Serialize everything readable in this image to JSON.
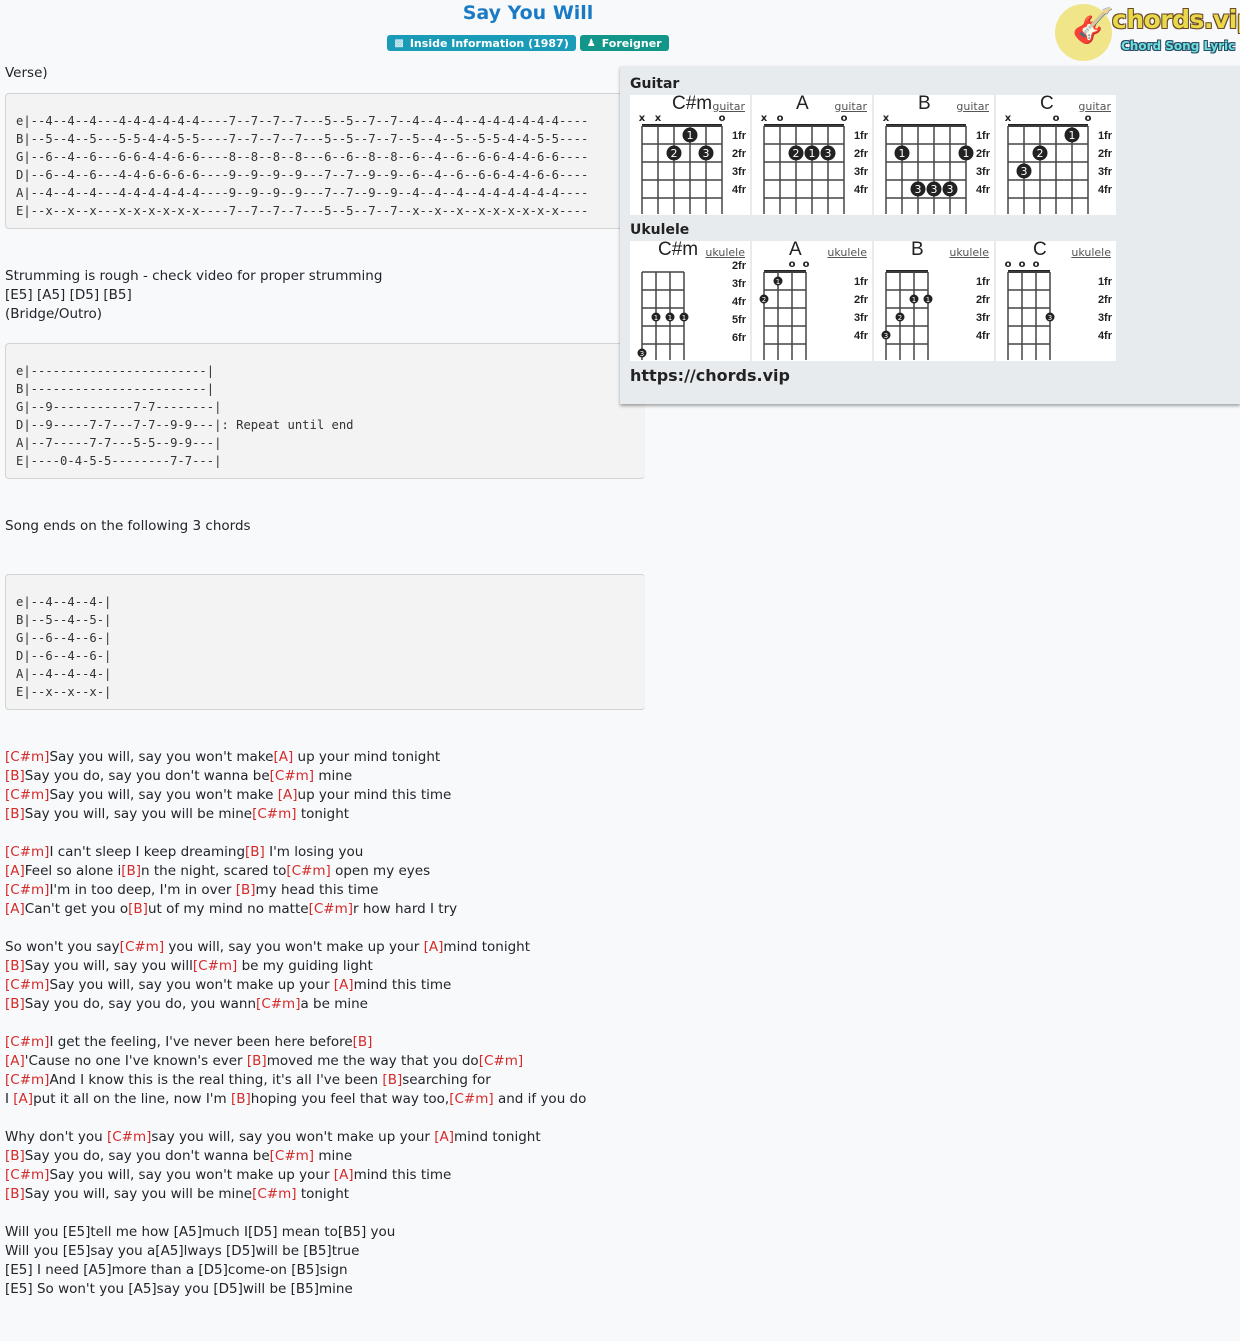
{
  "header": {
    "title": "Say You Will",
    "album_badge": "Inside Information (1987)",
    "artist_badge": "Foreigner",
    "album_icon": "book-icon",
    "artist_icon": "user-icon"
  },
  "logo": {
    "brand": "chords.vip",
    "tagline": "Chord Song Lyric",
    "icon": "guitar-icon"
  },
  "colors": {
    "title": "#1a7bc4",
    "album_badge": "#1a9bb8",
    "artist_badge": "#13968a",
    "chord": "#d42a2a"
  },
  "content": {
    "verse_label": "Verse)",
    "tab1": "e|--4--4--4---4-4-4-4-4-4----7--7--7--7---5--5--7--7--4--4--4--4-4-4-4-4-4----\nB|--5--4--5---5-5-4-4-5-5----7--7--7--7---5--5--7--7--5--4--5--5-5-4-4-5-5----\nG|--6--4--6---6-6-4-4-6-6----8--8--8--8---6--6--8--8--6--4--6--6-6-4-4-6-6----\nD|--6--4--6---4-4-6-6-6-6----9--9--9--9---7--7--9--9--6--4--6--6-6-4-4-6-6----\nA|--4--4--4---4-4-4-4-4-4----9--9--9--9---7--7--9--9--4--4--4--4-4-4-4-4-4----\nE|--x--x--x---x-x-x-x-x-x----7--7--7--7---5--5--7--7--x--x--x--x-x-x-x-x-x----",
    "strumming_note": "Strumming is rough - check video for proper strumming",
    "power_chords": "[E5] [A5] [D5] [B5]",
    "bridge_label": "(Bridge/Outro)",
    "tab2": "e|------------------------|\nB|------------------------|\nG|--9-----------7-7--------|\nD|--9-----7-7---7-7--9-9---|: Repeat until end\nA|--7-----7-7---5-5--9-9---|\nE|----0-4-5-5--------7-7---|",
    "ending_note": "Song ends on the following 3 chords",
    "tab3": "e|--4--4--4-|\nB|--5--4--5-|\nG|--6--4--6-|\nD|--6--4--6-|\nA|--4--4--4-|\nE|--x--x--x-|",
    "lyric_stanzas": [
      [
        [
          [
            "C#m",
            "Say you will, say you won't make"
          ],
          [
            "A",
            " up your mind tonight"
          ]
        ],
        [
          [
            "B",
            "Say you do, say you don't wanna be"
          ],
          [
            "C#m",
            " mine"
          ]
        ],
        [
          [
            "C#m",
            "Say you will, say you won't make "
          ],
          [
            "A",
            "up your mind this time"
          ]
        ],
        [
          [
            "B",
            "Say you will, say you will be mine"
          ],
          [
            "C#m",
            " tonight"
          ]
        ]
      ],
      [
        [
          [
            "C#m",
            "I can't sleep I keep dreaming"
          ],
          [
            "B",
            " I'm losing you"
          ]
        ],
        [
          [
            "A",
            "Feel so alone i"
          ],
          [
            "B",
            "n the night, scared to"
          ],
          [
            "C#m",
            " open my eyes"
          ]
        ],
        [
          [
            "C#m",
            "I'm in too deep, I'm in over "
          ],
          [
            "B",
            "my head this time"
          ]
        ],
        [
          [
            "A",
            "Can't get you o"
          ],
          [
            "B",
            "ut of my mind no matte"
          ],
          [
            "C#m",
            "r how hard I try"
          ]
        ]
      ],
      [
        [
          [
            "",
            "So won't you say"
          ],
          [
            "C#m",
            " you will, say you won't make up your "
          ],
          [
            "A",
            "mind tonight"
          ]
        ],
        [
          [
            "B",
            "Say you will, say you will"
          ],
          [
            "C#m",
            " be my guiding light"
          ]
        ],
        [
          [
            "C#m",
            "Say you will, say you won't make up your "
          ],
          [
            "A",
            "mind this time"
          ]
        ],
        [
          [
            "B",
            "Say you do, say you do, you wann"
          ],
          [
            "C#m",
            "a be mine"
          ]
        ]
      ],
      [
        [
          [
            "C#m",
            "I get the feeling, I've never been here before"
          ],
          [
            "B",
            ""
          ]
        ],
        [
          [
            "A",
            "'Cause no one I've known's ever "
          ],
          [
            "B",
            "moved me the way that you do"
          ],
          [
            "C#m",
            ""
          ]
        ],
        [
          [
            "C#m",
            "And I know this is the real thing, it's all I've been "
          ],
          [
            "B",
            "searching for"
          ]
        ],
        [
          [
            "",
            "I "
          ],
          [
            "A",
            "put it all on the line, now I'm "
          ],
          [
            "B",
            "hoping you feel that way too,"
          ],
          [
            "C#m",
            " and if you do"
          ]
        ]
      ],
      [
        [
          [
            "",
            "Why don't you "
          ],
          [
            "C#m",
            "say you will, say you won't make up your "
          ],
          [
            "A",
            "mind tonight"
          ]
        ],
        [
          [
            "B",
            "Say you do, say you don't wanna be"
          ],
          [
            "C#m",
            " mine"
          ]
        ],
        [
          [
            "C#m",
            "Say you will, say you won't make up your "
          ],
          [
            "A",
            "mind this time"
          ]
        ],
        [
          [
            "B",
            "Say you will, say you will be mine"
          ],
          [
            "C#m",
            " tonight"
          ]
        ]
      ]
    ],
    "plain_lines": [
      "Will you [E5]tell me how [A5]much I[D5] mean to[B5] you",
      "Will you [E5]say you a[A5]lways [D5]will be [B5]true",
      "[E5] I need [A5]more than a [D5]come-on [B5]sign",
      "[E5] So won't you [A5]say you [D5]will be [B5]mine"
    ]
  },
  "chord_panel": {
    "guitar_label": "Guitar",
    "ukulele_label": "Ukulele",
    "site_url": "https://chords.vip",
    "guitar": [
      {
        "name": "C#m",
        "instrument": "guitar",
        "start_fret": 1,
        "fret_labels": [
          "1fr",
          "2fr",
          "3fr",
          "4fr"
        ],
        "strings": [
          "x",
          "x",
          "",
          "",
          "",
          "o"
        ],
        "dots": [
          [
            4,
            1,
            "1"
          ],
          [
            3,
            2,
            "2"
          ],
          [
            5,
            2,
            "3"
          ]
        ]
      },
      {
        "name": "A",
        "instrument": "guitar",
        "start_fret": 1,
        "fret_labels": [
          "1fr",
          "2fr",
          "3fr",
          "4fr"
        ],
        "strings": [
          "x",
          "o",
          "",
          "",
          "",
          "o"
        ],
        "dots": [
          [
            3,
            2,
            "2"
          ],
          [
            4,
            2,
            "1"
          ],
          [
            5,
            2,
            "3"
          ]
        ]
      },
      {
        "name": "B",
        "instrument": "guitar",
        "start_fret": 1,
        "fret_labels": [
          "1fr",
          "2fr",
          "3fr",
          "4fr"
        ],
        "strings": [
          "x",
          "",
          "",
          "",
          "",
          ""
        ],
        "dots": [
          [
            2,
            2,
            "1"
          ],
          [
            6,
            2,
            "1"
          ],
          [
            3,
            4,
            "3"
          ],
          [
            4,
            4,
            "3"
          ],
          [
            5,
            4,
            "3"
          ]
        ]
      },
      {
        "name": "C",
        "instrument": "guitar",
        "start_fret": 1,
        "fret_labels": [
          "1fr",
          "2fr",
          "3fr",
          "4fr"
        ],
        "strings": [
          "x",
          "",
          "",
          "o",
          "",
          "o"
        ],
        "dots": [
          [
            5,
            1,
            "1"
          ],
          [
            3,
            2,
            "2"
          ],
          [
            2,
            3,
            "3"
          ]
        ]
      }
    ],
    "ukulele": [
      {
        "name": "C#m",
        "instrument": "ukulele",
        "fret_labels": [
          "2fr",
          "3fr",
          "4fr",
          "5fr",
          "6fr"
        ],
        "strings": [
          "",
          "",
          "",
          ""
        ],
        "dots": [
          [
            2,
            3,
            "1"
          ],
          [
            3,
            3,
            "1"
          ],
          [
            4,
            3,
            "1"
          ],
          [
            1,
            5,
            "3"
          ]
        ]
      },
      {
        "name": "A",
        "instrument": "ukulele",
        "fret_labels": [
          "1fr",
          "2fr",
          "3fr",
          "4fr"
        ],
        "strings": [
          "",
          "",
          "o",
          "o"
        ],
        "dots": [
          [
            2,
            1,
            "1"
          ],
          [
            1,
            2,
            "2"
          ]
        ]
      },
      {
        "name": "B",
        "instrument": "ukulele",
        "fret_labels": [
          "1fr",
          "2fr",
          "3fr",
          "4fr"
        ],
        "strings": [
          "",
          "",
          "",
          ""
        ],
        "dots": [
          [
            3,
            2,
            "1"
          ],
          [
            4,
            2,
            "1"
          ],
          [
            2,
            3,
            "2"
          ],
          [
            1,
            4,
            "3"
          ]
        ]
      },
      {
        "name": "C",
        "instrument": "ukulele",
        "fret_labels": [
          "1fr",
          "2fr",
          "3fr",
          "4fr"
        ],
        "strings": [
          "o",
          "o",
          "o",
          ""
        ],
        "dots": [
          [
            4,
            3,
            "3"
          ]
        ]
      }
    ]
  }
}
